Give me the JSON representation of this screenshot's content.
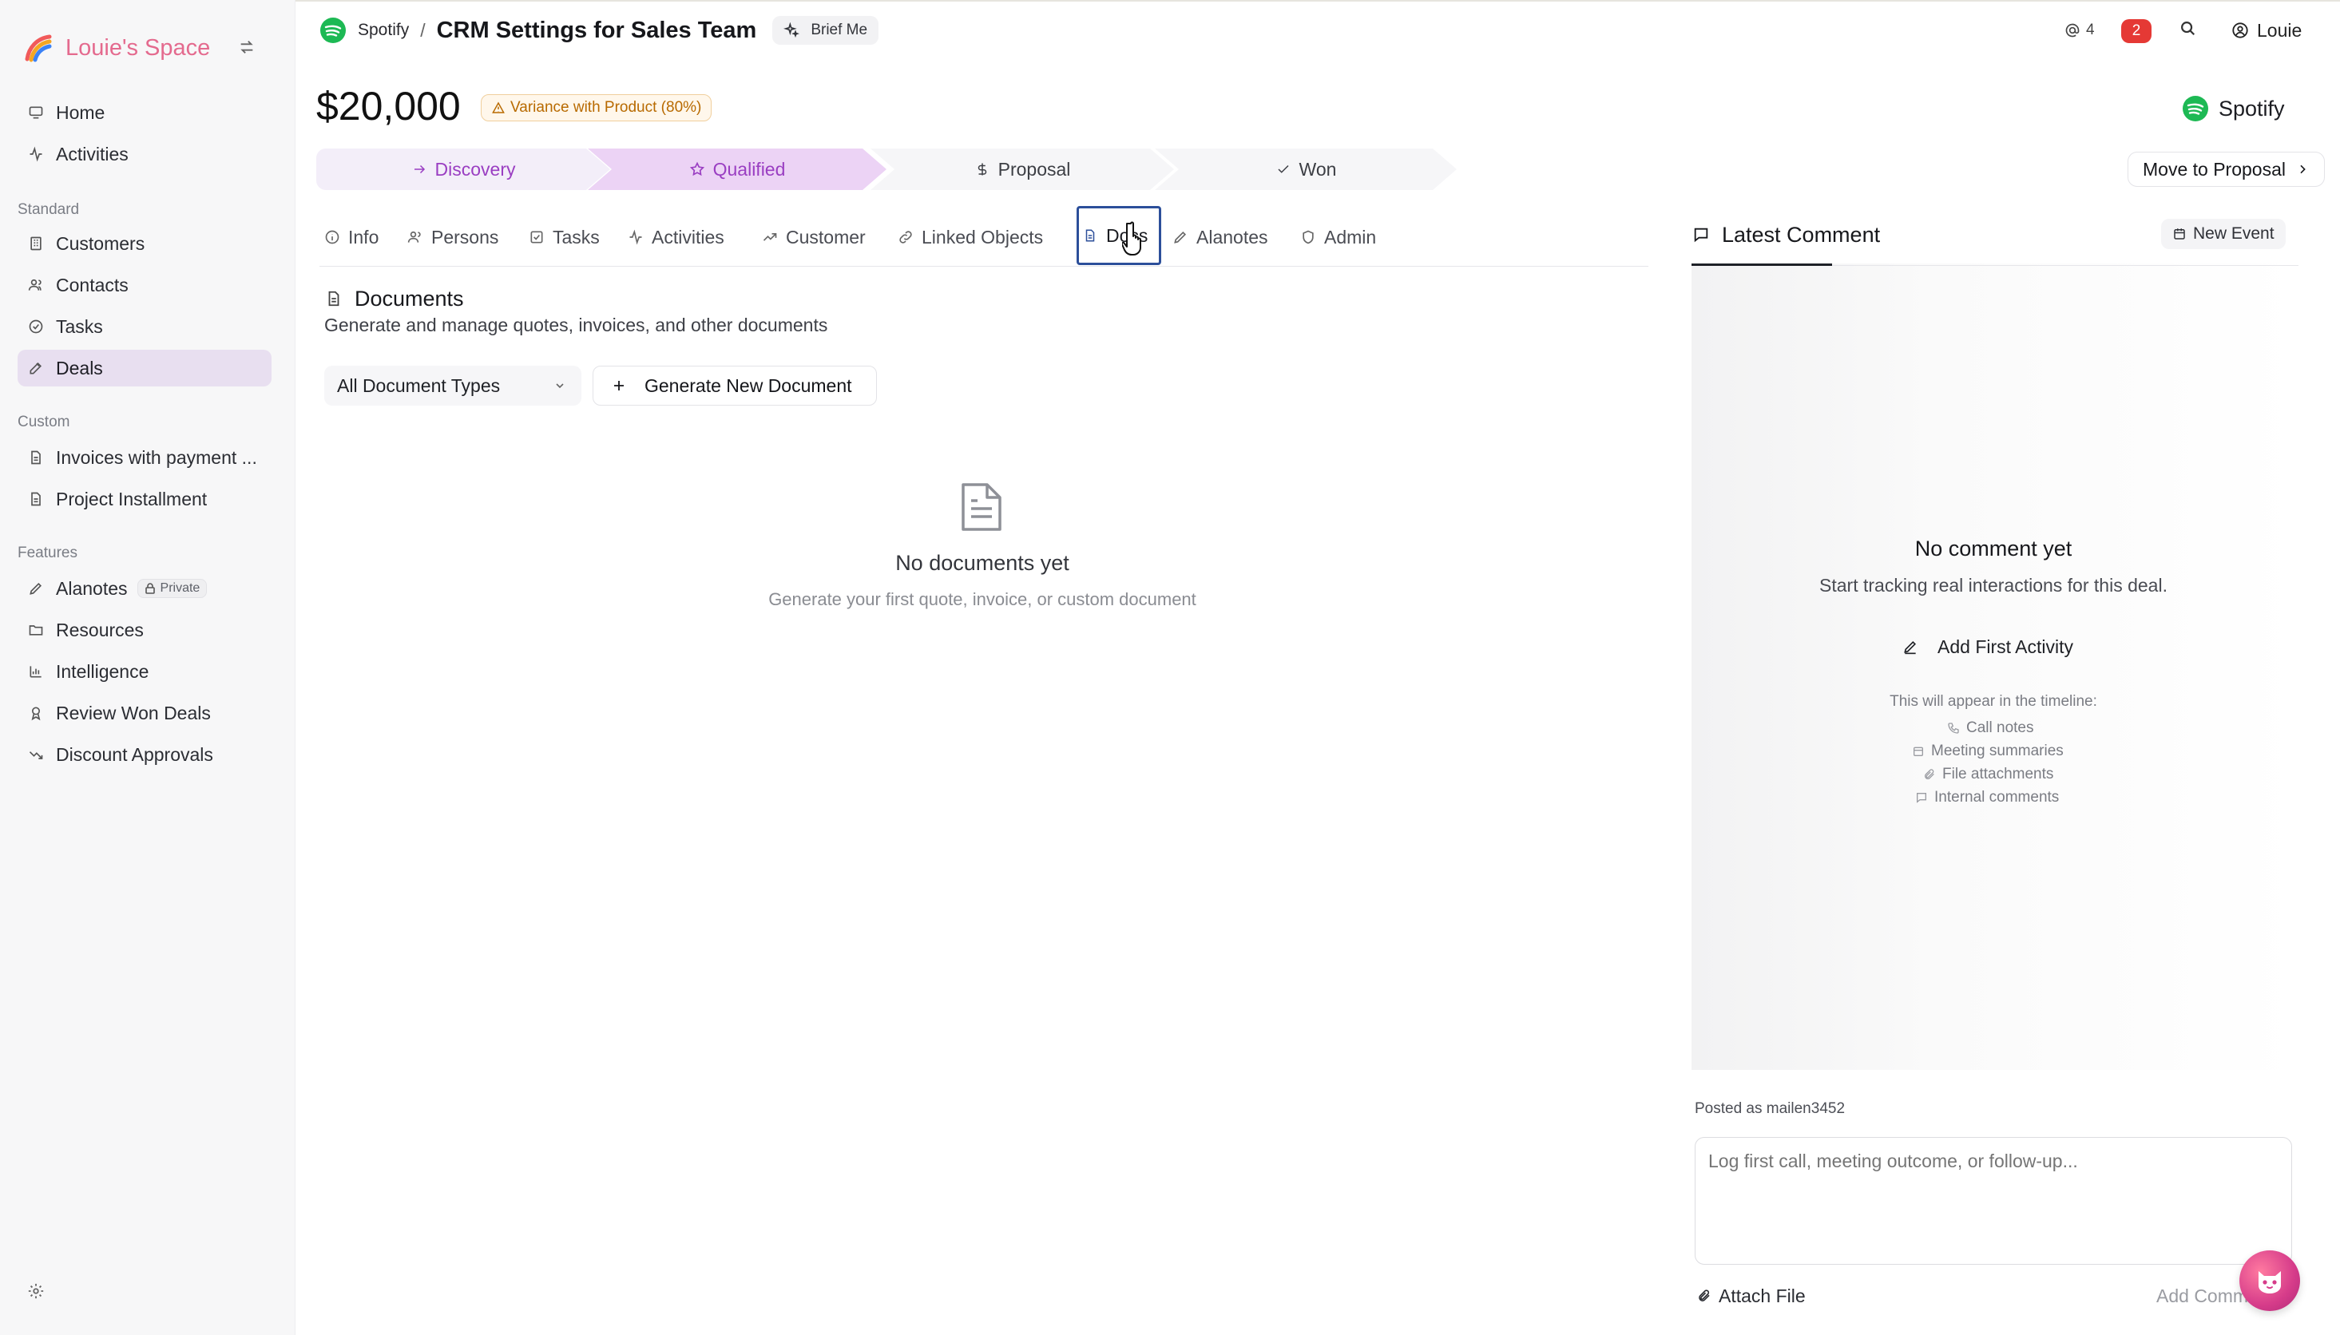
{
  "sidebar": {
    "brand": "Louie's Space",
    "top_items": [
      {
        "label": "Home",
        "icon": "monitor-icon"
      },
      {
        "label": "Activities",
        "icon": "activity-icon"
      }
    ],
    "standard_label": "Standard",
    "standard_items": [
      {
        "label": "Customers",
        "icon": "building-icon"
      },
      {
        "label": "Contacts",
        "icon": "users-icon"
      },
      {
        "label": "Tasks",
        "icon": "check-circle-icon"
      },
      {
        "label": "Deals",
        "icon": "edit-icon",
        "active": true
      }
    ],
    "custom_label": "Custom",
    "custom_items": [
      {
        "label": "Invoices with payment ...",
        "icon": "file-icon"
      },
      {
        "label": "Project Installment",
        "icon": "file-icon"
      }
    ],
    "features_label": "Features",
    "feature_items": [
      {
        "label": "Alanotes",
        "icon": "pen-icon",
        "badge": "Private"
      },
      {
        "label": "Resources",
        "icon": "folder-icon"
      },
      {
        "label": "Intelligence",
        "icon": "bar-chart-icon"
      },
      {
        "label": "Review Won Deals",
        "icon": "award-icon"
      },
      {
        "label": "Discount Approvals",
        "icon": "trend-down-icon"
      }
    ]
  },
  "header": {
    "company": "Spotify",
    "separator": "/",
    "title": "CRM Settings for Sales Team",
    "brief_me": "Brief Me",
    "mentions": "4",
    "notifications": "2",
    "user": "Louie"
  },
  "deal": {
    "amount": "$20,000",
    "variance": "Variance with Product (80%)",
    "company": "Spotify",
    "stages": [
      {
        "label": "Discovery",
        "icon": "arrow-right-icon"
      },
      {
        "label": "Qualified",
        "icon": "star-icon"
      },
      {
        "label": "Proposal",
        "icon": "dollar-icon"
      },
      {
        "label": "Won",
        "icon": "check-icon"
      }
    ],
    "move_button": "Move to Proposal"
  },
  "tabs": [
    {
      "label": "Info",
      "icon": "info-icon"
    },
    {
      "label": "Persons",
      "icon": "users-icon"
    },
    {
      "label": "Tasks",
      "icon": "check-square-icon"
    },
    {
      "label": "Activities",
      "icon": "activity-icon"
    },
    {
      "label": "Customer",
      "icon": "trend-icon"
    },
    {
      "label": "Linked Objects",
      "icon": "link-icon"
    },
    {
      "label": "Docs",
      "icon": "file-icon",
      "active": true
    },
    {
      "label": "Alanotes",
      "icon": "pen-icon"
    },
    {
      "label": "Admin",
      "icon": "shield-icon"
    }
  ],
  "documents": {
    "title": "Documents",
    "subtitle": "Generate and manage quotes, invoices, and other documents",
    "type_filter": "All Document Types",
    "generate_button": "Generate New Document",
    "empty_title": "No documents yet",
    "empty_subtitle": "Generate your first quote, invoice, or custom document"
  },
  "comments": {
    "tab_label": "Latest Comment",
    "new_event": "New Event",
    "empty_title": "No comment yet",
    "empty_subtitle": "Start tracking real interactions for this deal.",
    "add_first": "Add First Activity",
    "timeline_note": "This will appear in the timeline:",
    "timeline_items": [
      {
        "label": "Call notes",
        "icon": "phone-icon"
      },
      {
        "label": "Meeting summaries",
        "icon": "calendar-icon"
      },
      {
        "label": "File attachments",
        "icon": "paperclip-icon"
      },
      {
        "label": "Internal comments",
        "icon": "comment-icon"
      }
    ],
    "posted_as": "Posted as mailen3452",
    "placeholder": "Log first call, meeting outcome, or follow-up...",
    "attach_file": "Attach File",
    "add_comment": "Add Comment"
  },
  "colors": {
    "accent_purple": "#9a3ec2",
    "active_nav": "#e8dff0",
    "brand_pink": "#e46a8e",
    "spotify_green": "#1db954",
    "alert_red": "#e53935"
  }
}
